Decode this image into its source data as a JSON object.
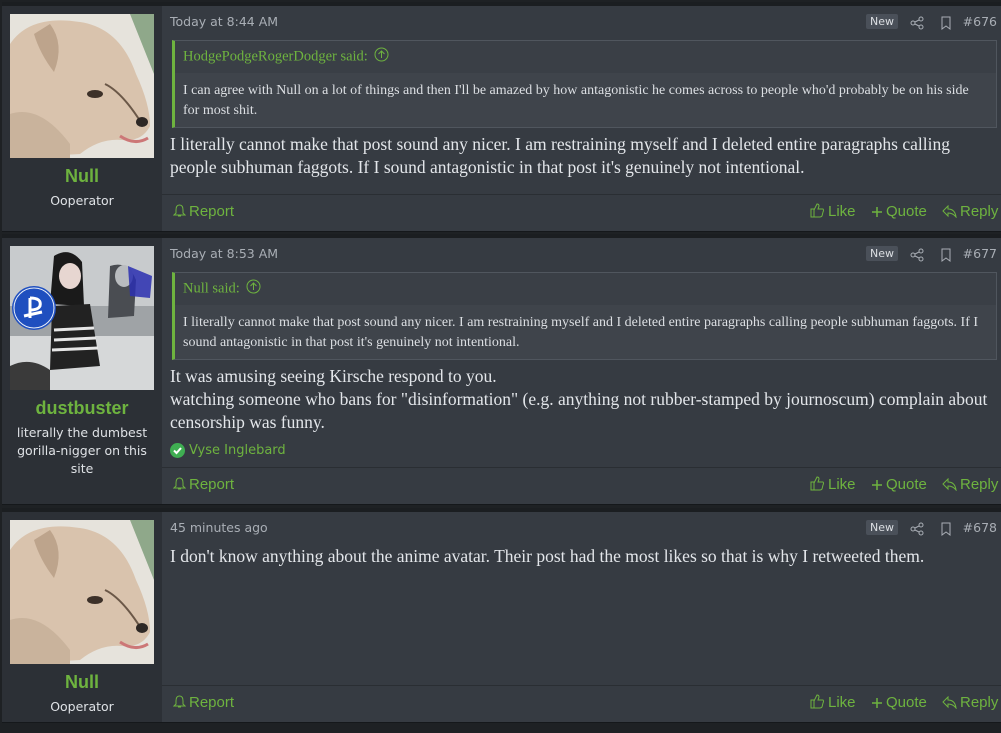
{
  "posts": [
    {
      "username": "Null",
      "user_title": "Ooperator",
      "timestamp": "Today at 8:44 AM",
      "badge": "New",
      "post_number": "#676",
      "quote": {
        "author_said": "HodgePodgeRogerDodger said:",
        "text": "I can agree with Null on a lot of things and then I'll be amazed by how antagonistic he comes across to people who'd probably be on his side for most shit."
      },
      "body": [
        "I literally cannot make that post sound any nicer. I am restraining myself and I deleted entire paragraphs calling people subhuman faggots. If I sound antagonistic in that post it's genuinely not intentional."
      ]
    },
    {
      "username": "dustbuster",
      "user_title": "literally the dumbest gorilla-nigger on this site",
      "timestamp": "Today at 8:53 AM",
      "badge": "New",
      "post_number": "#677",
      "quote": {
        "author_said": "Null said:",
        "text": "I literally cannot make that post sound any nicer. I am restraining myself and I deleted entire paragraphs calling people subhuman faggots. If I sound antagonistic in that post it's genuinely not intentional."
      },
      "body": [
        "It was amusing seeing Kirsche respond to you.",
        "watching someone who bans for \"disinformation\" (e.g. anything not rubber-stamped by journoscum) complain about censorship was funny."
      ],
      "reaction_user": "Vyse Inglebard"
    },
    {
      "username": "Null",
      "user_title": "Ooperator",
      "timestamp": "45 minutes ago",
      "badge": "New",
      "post_number": "#678",
      "body": [
        "I don't know anything about the anime avatar. Their post had the most likes so that is why I retweeted them."
      ]
    }
  ],
  "actions": {
    "report": "Report",
    "like": "Like",
    "quote": "Quote",
    "reply": "Reply"
  },
  "colors": {
    "accent": "#6eb33f",
    "post_bg": "#363b42",
    "user_bg": "#2c3036"
  }
}
